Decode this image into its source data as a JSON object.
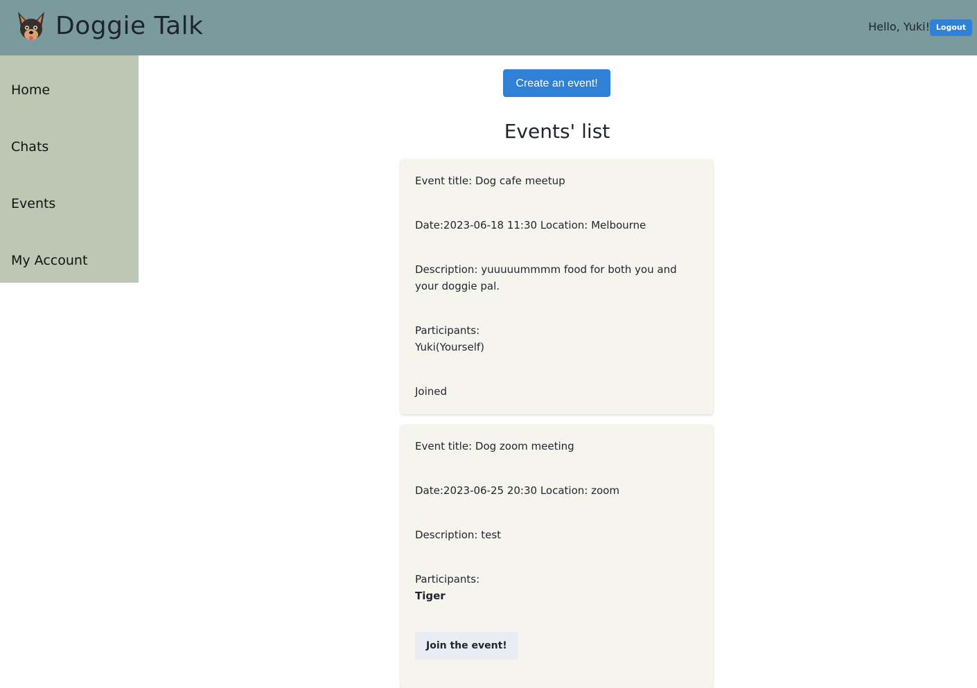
{
  "header": {
    "brand": "Doggie Talk",
    "greeting": "Hello, Yuki!",
    "logout_label": "Logout",
    "logo_icon": "dog-face-icon",
    "background_color": "#7a9a9b"
  },
  "sidebar": {
    "background_color": "#bdc8b4",
    "items": [
      {
        "label": "Home"
      },
      {
        "label": "Chats"
      },
      {
        "label": "Events"
      },
      {
        "label": "My Account"
      }
    ]
  },
  "main": {
    "create_event_label": "Create an event!",
    "list_title": "Events' list",
    "accent_color": "#2f80d6",
    "events": [
      {
        "title": "Event title: Dog cafe meetup",
        "datetime_location": "Date:2023-06-18 11:30 Location: Melbourne",
        "description": "Description: yuuuuummmm food for both you and your doggie pal.",
        "participants_label": "Participants:",
        "participants": "Yuki(Yourself)",
        "status": "Joined"
      },
      {
        "title": "Event title: Dog zoom meeting",
        "datetime_location": "Date:2023-06-25 20:30 Location: zoom",
        "description": "Description: test",
        "participants_label": "Participants:",
        "participants": "Tiger",
        "join_label": "Join the event!"
      }
    ]
  }
}
